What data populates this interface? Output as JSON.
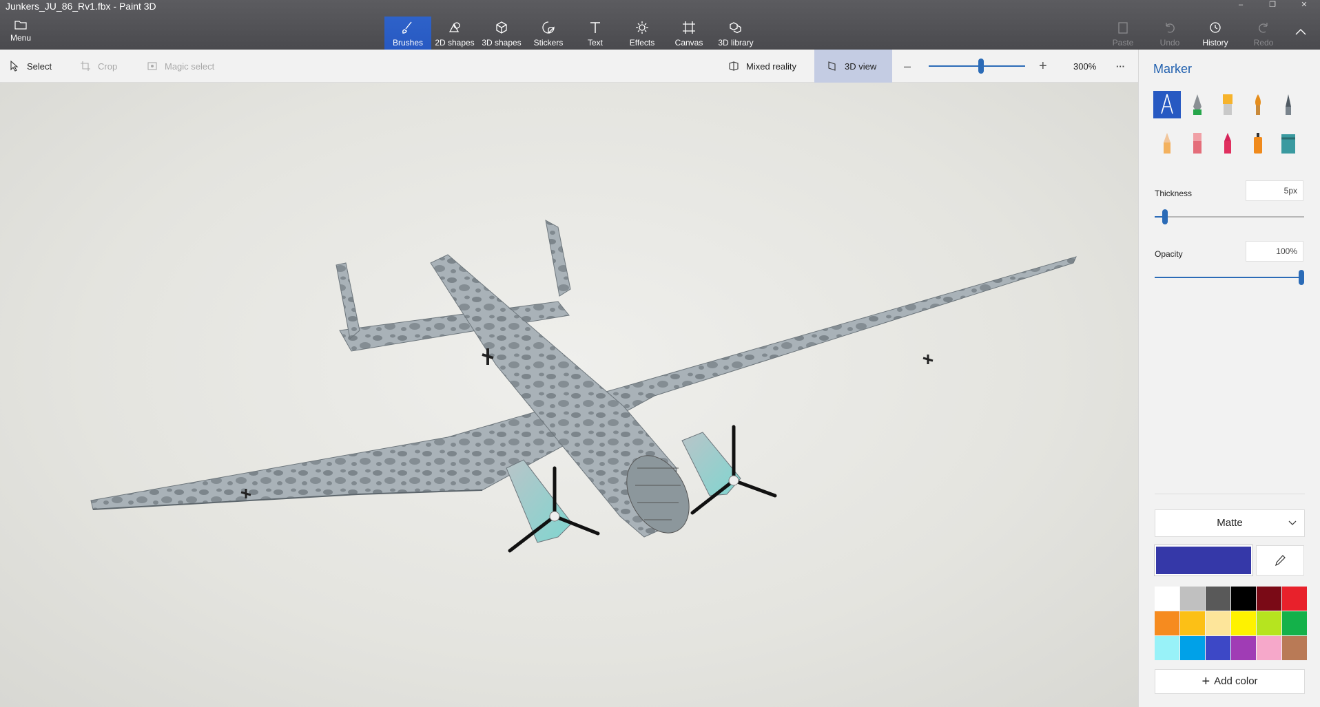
{
  "window": {
    "title": "Junkers_JU_86_Rv1.fbx - Paint 3D",
    "controls": [
      "–",
      "❐",
      "✕"
    ]
  },
  "ribbon": {
    "menu_label": "Menu",
    "tools": [
      {
        "label": "Brushes",
        "icon": "brush-icon",
        "active": true
      },
      {
        "label": "2D shapes",
        "icon": "2d-shapes-icon"
      },
      {
        "label": "3D shapes",
        "icon": "3d-shapes-icon"
      },
      {
        "label": "Stickers",
        "icon": "stickers-icon"
      },
      {
        "label": "Text",
        "icon": "text-icon"
      },
      {
        "label": "Effects",
        "icon": "effects-icon"
      },
      {
        "label": "Canvas",
        "icon": "canvas-icon"
      },
      {
        "label": "3D library",
        "icon": "3d-library-icon"
      }
    ],
    "right": {
      "paste": "Paste",
      "undo": "Undo",
      "history": "History",
      "redo": "Redo"
    }
  },
  "toolbar": {
    "select": "Select",
    "crop": "Crop",
    "magic_select": "Magic select",
    "mixed_reality": "Mixed reality",
    "view_3d": "3D view",
    "zoom": "300%",
    "more": "···"
  },
  "panel": {
    "title": "Marker",
    "thickness_label": "Thickness",
    "thickness_value": "5px",
    "thickness_level": 0.05,
    "opacity_label": "Opacity",
    "opacity_value": "100%",
    "opacity_level": 1.0,
    "finish": "Matte",
    "current_color": "#3538a8",
    "add_color": "Add color",
    "palette": [
      "#ffffff",
      "#c0c0c0",
      "#595959",
      "#000000",
      "#7a0a16",
      "#e8212b",
      "#f68b1f",
      "#fcc016",
      "#fde59a",
      "#fef200",
      "#b6e41f",
      "#14b14a",
      "#98f2f8",
      "#00a1e8",
      "#3d48c6",
      "#a03cb5",
      "#f6a8ca",
      "#b97a56"
    ]
  }
}
